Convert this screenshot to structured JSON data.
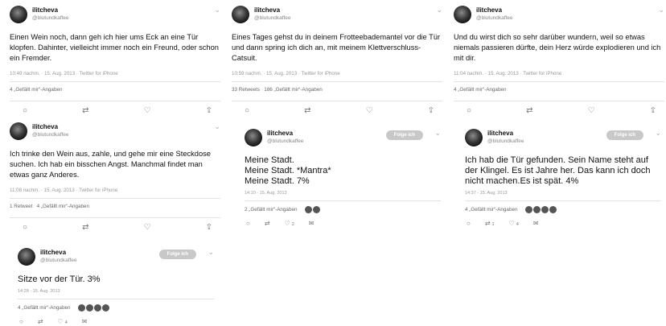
{
  "tweets": [
    {
      "name": "ilitcheva",
      "handle": "@blutundkaffee",
      "text": "Einen Wein noch, dann geh ich hier ums Eck an eine Tür klopfen. Dahinter, vielleicht immer noch ein Freund, oder schon ein Fremder.",
      "meta": "10:49 nachm. · 15. Aug. 2013 · Twitter for iPhone",
      "stats": "4 „Gefällt mir“-Angaben"
    },
    {
      "name": "ilitcheva",
      "handle": "@blutundkaffee",
      "text": "Eines Tages gehst du in deinem Frotteebademantel vor die Tür und dann spring ich dich an, mit meinem Klettverschluss-Catsuit.",
      "meta": "10:59 nachm. · 15. Aug. 2013 · Twitter for iPhone",
      "stats": "33 Retweets   186 „Gefällt mir“-Angaben"
    },
    {
      "name": "ilitcheva",
      "handle": "@blutundkaffee",
      "text": "Und du wirst dich so sehr darüber wundern, weil so etwas niemals passieren dürfte, dein Herz würde explodieren und ich mit dir.",
      "meta": "11:04 nachm. · 15. Aug. 2013 · Twitter for iPhone",
      "stats": "4 „Gefällt mir“-Angaben"
    },
    {
      "name": "ilitcheva",
      "handle": "@blutundkaffee",
      "text": "Ich trinke den Wein aus, zahle, und gehe mir eine Steckdose suchen. Ich hab ein bisschen Angst. Manchmal findet man etwas ganz Anderes.",
      "meta": "11:08 nachm. · 15. Aug. 2013 · Twitter for iPhone",
      "stats": "1 Retweet   4 „Gefällt mir“-Angaben"
    },
    {
      "name": "ilitcheva",
      "handle": "@blutundkaffee",
      "follow": "Folge ich",
      "text": "Meine Stadt.\nMeine Stadt. *Mantra*\nMeine Stadt. 7%",
      "meta": "14:10 - 15. Aug. 2013",
      "stats": "2 „Gefällt mir“-Angaben",
      "like_count": "2"
    },
    {
      "name": "ilitcheva",
      "handle": "@blutundkaffee",
      "follow": "Folge ich",
      "text": "Ich hab die Tür gefunden. Sein Name steht auf der Klingel. Es ist Jahre her. Das kann ich doch nicht machen.Es ist spät. 4%",
      "meta": "14:37 - 15. Aug. 2013",
      "stats": "4 „Gefällt mir“-Angaben",
      "retweet_count": "1",
      "like_count": "4"
    },
    {
      "name": "ilitcheva",
      "handle": "@blutundkaffee",
      "follow": "Folge ich",
      "text": "Sitze vor der Tür. 3%",
      "meta": "14:28 - 15. Aug. 2013",
      "stats": "4 „Gefällt mir“-Angaben",
      "like_count": "4"
    }
  ],
  "icons": {
    "reply": "reply-icon",
    "retweet": "retweet-icon",
    "like": "heart-icon",
    "share": "share-icon",
    "dm": "message-icon",
    "more": "chevron-down-icon"
  }
}
